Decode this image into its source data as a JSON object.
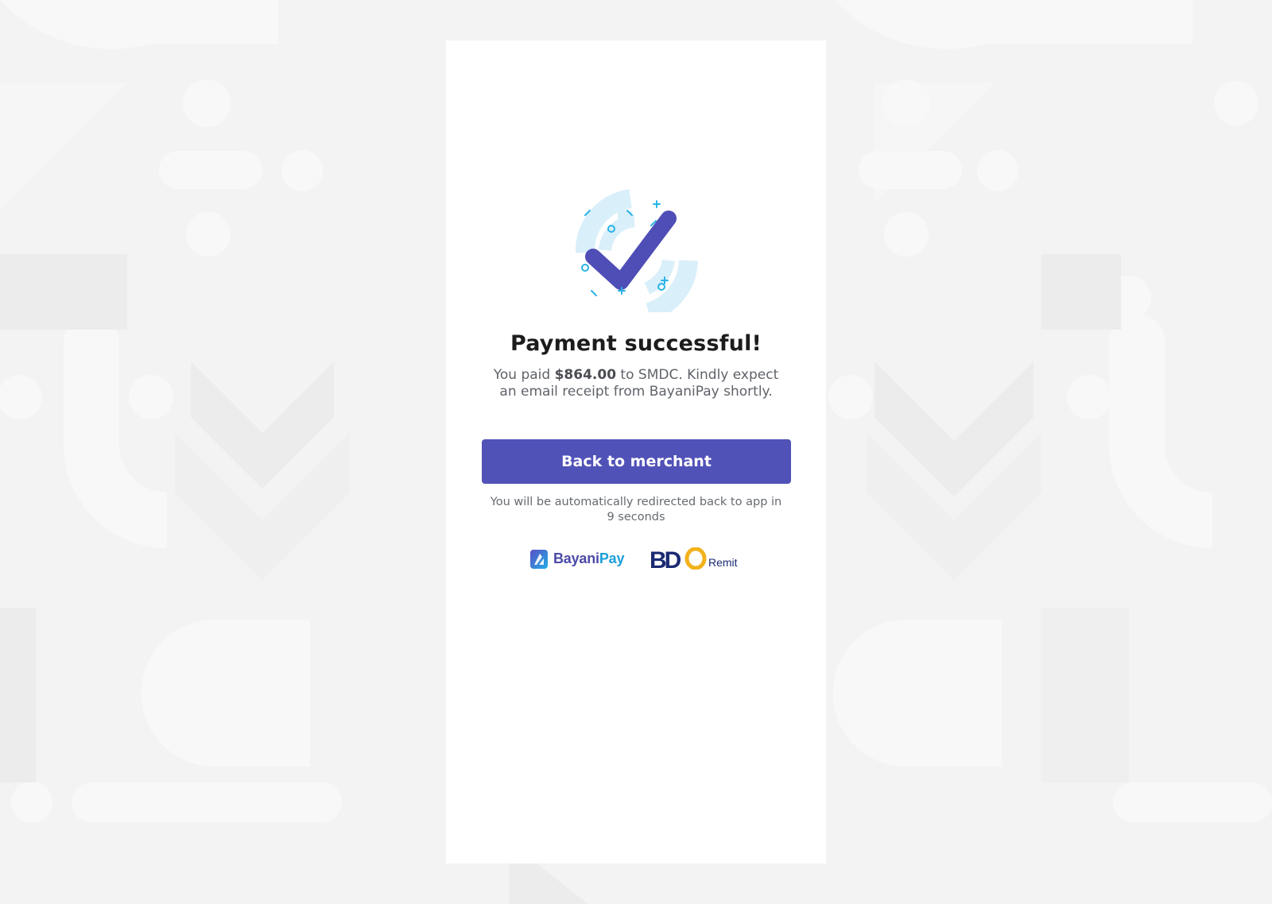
{
  "page": {
    "title": "Payment successful!",
    "message_prefix": "You paid ",
    "amount": "$864.00",
    "message_suffix": " to SMDC. Kindly expect an email receipt from BayaniPay shortly.",
    "button_label": "Back to merchant",
    "redirect_note": "You will be automatically redirected back to app in 9 seconds"
  },
  "logos": {
    "bayanipay_name_part1": "Bayani",
    "bayanipay_name_part2": "Pay",
    "bdo_wordmark": "BDO",
    "bdo_remit": "Remit"
  },
  "icons": {
    "success": "check-icon",
    "bayanipay": "bayanipay-logo-icon",
    "bdo": "bdo-logo-icon"
  },
  "colors": {
    "primary": "#5152b8",
    "check": "#4f4db6",
    "accent_light": "#d9effa",
    "accent_cyan": "#2bb3e6",
    "bdo_navy": "#1a2a72",
    "bdo_gold": "#f2b21c"
  }
}
